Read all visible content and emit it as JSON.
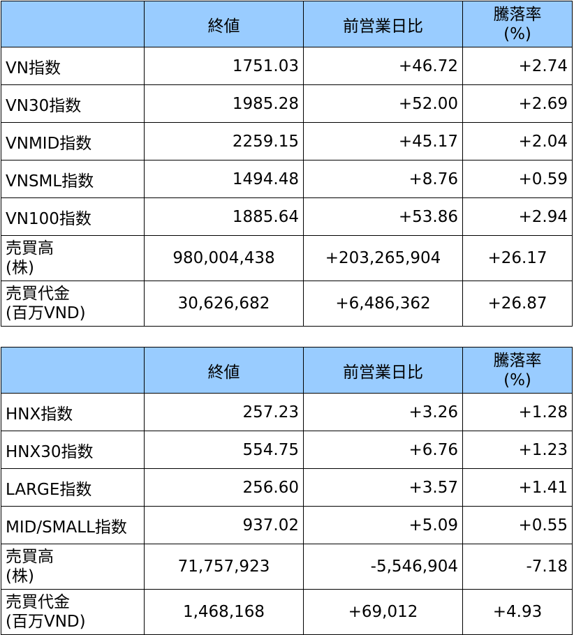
{
  "headers": {
    "close": "終値",
    "change": "前営業日比",
    "pct_line1": "騰落率",
    "pct_line2": "(%)"
  },
  "table1": {
    "rows": [
      {
        "name": "VN指数",
        "close": "1751.03",
        "change": "+46.72",
        "pct": "+2.74"
      },
      {
        "name": "VN30指数",
        "close": "1985.28",
        "change": "+52.00",
        "pct": "+2.69"
      },
      {
        "name": "VNMID指数",
        "close": "2259.15",
        "change": "+45.17",
        "pct": "+2.04"
      },
      {
        "name": "VNSML指数",
        "close": "1494.48",
        "change": "+8.76",
        "pct": "+0.59"
      },
      {
        "name": "VN100指数",
        "close": "1885.64",
        "change": "+53.86",
        "pct": "+2.94"
      }
    ],
    "volume": {
      "name1": "売買高",
      "name2": "(株)",
      "close": "980,004,438",
      "change": "+203,265,904",
      "pct": "+26.17"
    },
    "value": {
      "name1": "売買代金",
      "name2": "(百万VND)",
      "close": "30,626,682",
      "change": "+6,486,362",
      "pct": "+26.87"
    }
  },
  "table2": {
    "rows": [
      {
        "name": "HNX指数",
        "close": "257.23",
        "change": "+3.26",
        "pct": "+1.28"
      },
      {
        "name": "HNX30指数",
        "close": "554.75",
        "change": "+6.76",
        "pct": "+1.23"
      },
      {
        "name": "LARGE指数",
        "close": "256.60",
        "change": "+3.57",
        "pct": "+1.41"
      },
      {
        "name": "MID/SMALL指数",
        "close": "937.02",
        "change": "+5.09",
        "pct": "+0.55"
      }
    ],
    "volume": {
      "name1": "売買高",
      "name2": "(株)",
      "close": "71,757,923",
      "change": "-5,546,904",
      "pct": "-7.18"
    },
    "value": {
      "name1": "売買代金",
      "name2": "(百万VND)",
      "close": "1,468,168",
      "change": "+69,012",
      "pct": "+4.93"
    }
  }
}
